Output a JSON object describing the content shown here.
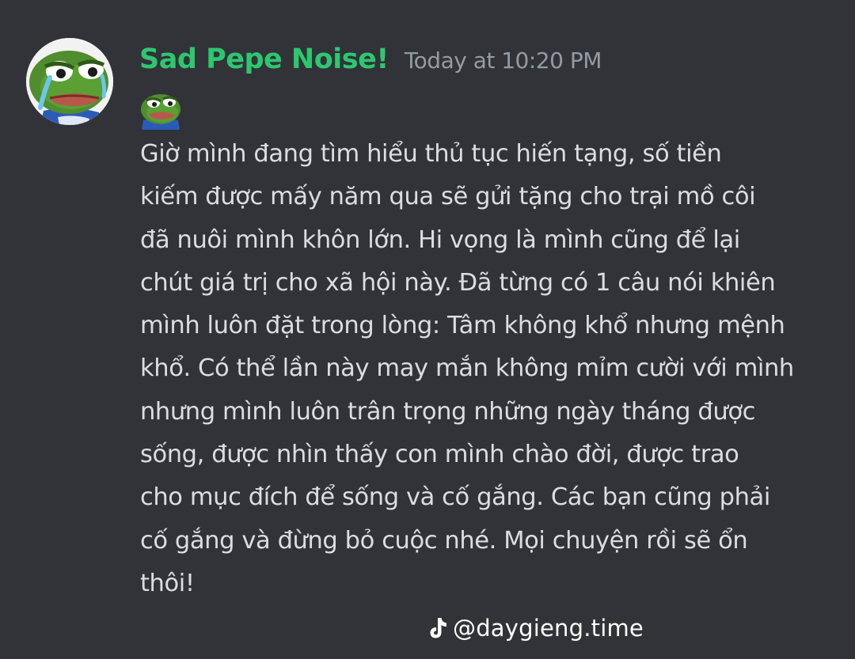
{
  "message": {
    "author": "Sad Pepe Noise!",
    "timestamp": "Today at 10:20 PM",
    "avatar_icon": "sad-pepe-avatar",
    "emoji_icon": "pepe-emoji",
    "lines": [
      "Giờ mình đang tìm hiểu thủ tục hiến tạng, số tiền",
      "kiếm được mấy năm qua sẽ gửi tặng cho trại mồ côi",
      "đã nuôi mình khôn lớn. Hi vọng là mình cũng để lại",
      "chút giá trị cho xã hội này. Đã từng có 1 câu nói khiên",
      "mình luôn đặt trong lòng: Tâm không khổ nhưng mệnh",
      "khổ. Có thể lần này may mắn không mỉm cười với mình",
      "nhưng mình luôn trân trọng những ngày tháng được",
      "sống, được nhìn thấy con mình chào đời, được trao",
      "cho mục đích để sống và cố gắng. Các bạn cũng phải",
      "cố gắng và đừng bỏ cuộc nhé. Mọi chuyện rồi sẽ ổn",
      "thôi!"
    ]
  },
  "watermark": {
    "text": "@daygieng.time",
    "icon": "tiktok-icon"
  },
  "colors": {
    "background": "#313338",
    "username": "#2dc770",
    "timestamp": "#949ba4",
    "text": "#dbdee1",
    "watermark": "#ffffff"
  }
}
